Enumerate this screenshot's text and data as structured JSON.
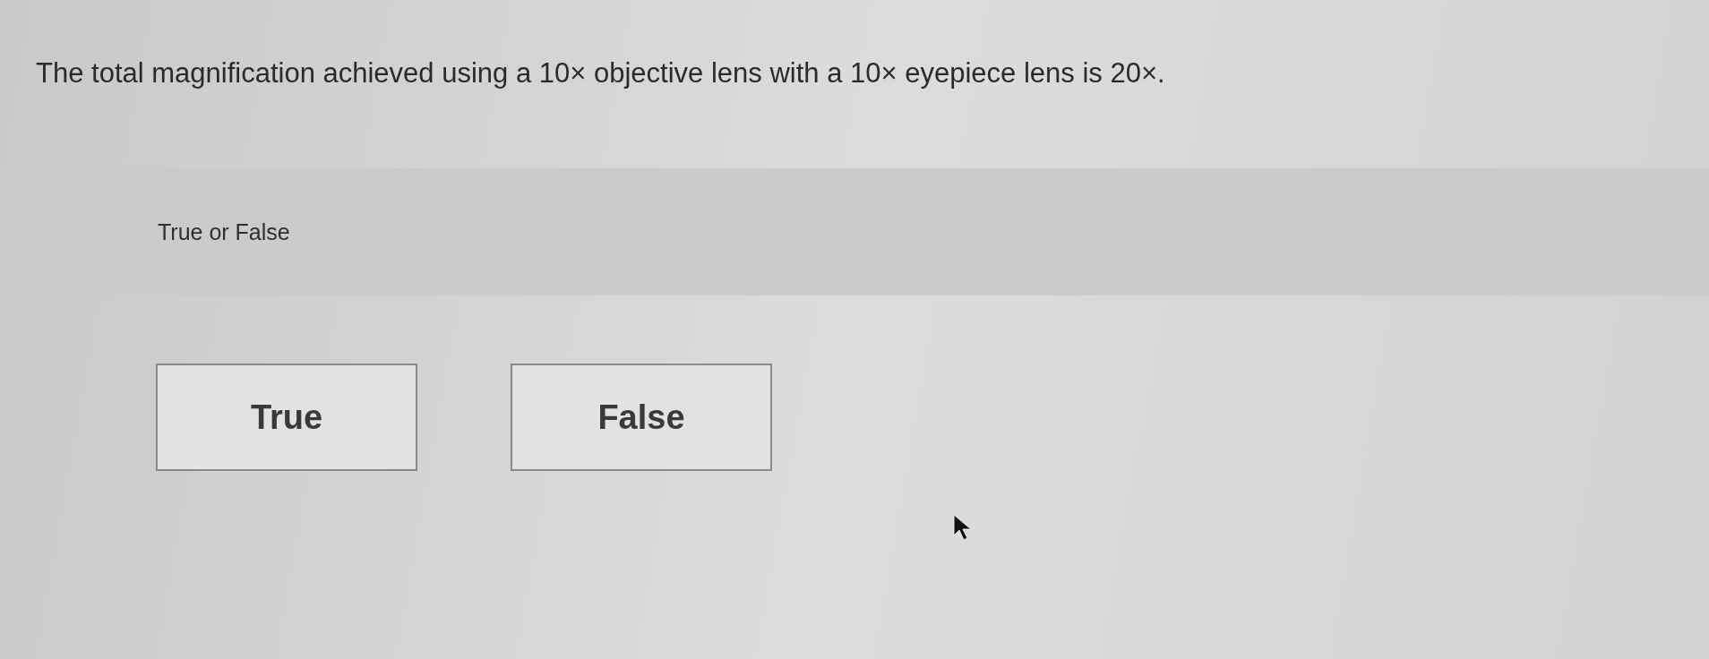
{
  "question": {
    "text": "The total magnification achieved using a 10× objective lens with a 10× eyepiece lens is 20×."
  },
  "prompt": "True or False",
  "options": [
    {
      "label": "True",
      "selected": false
    },
    {
      "label": "False",
      "selected": false
    }
  ]
}
